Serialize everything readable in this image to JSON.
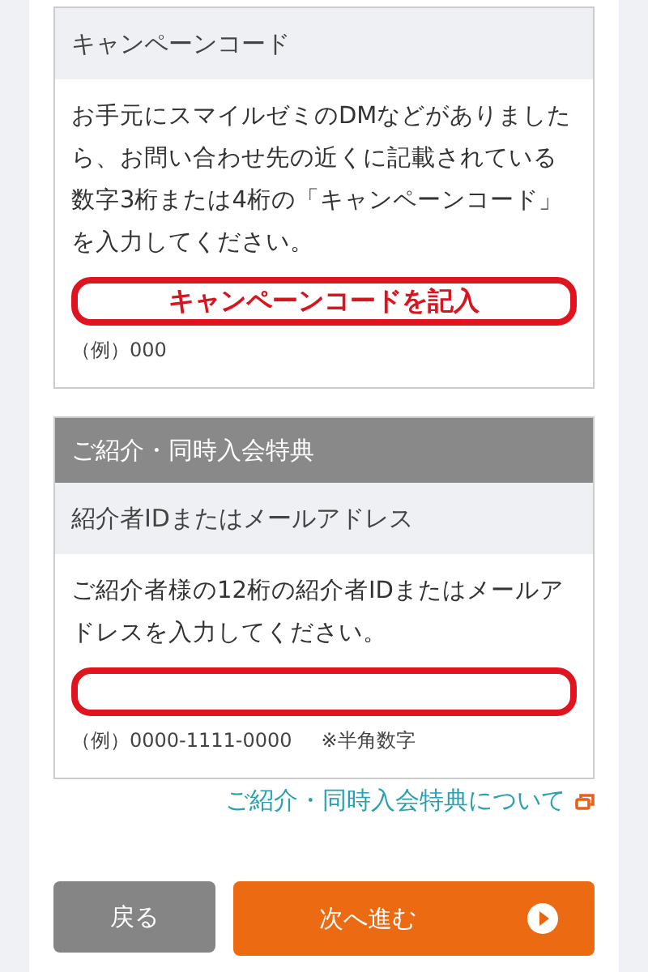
{
  "campaign": {
    "title": "キャンペーンコード",
    "description": "お手元にスマイルゼミのDMなどがありましたら、お問い合わせ先の近くに記載されている数字3桁または4桁の「キャンペーンコード」を入力してください。",
    "field": {
      "value": "キャンペーンコードを記入"
    },
    "example": "（例）000"
  },
  "referral": {
    "banner": "ご紹介・同時入会特典",
    "title": "紹介者IDまたはメールアドレス",
    "description": "ご紹介者様の12桁の紹介者IDまたはメールアドレスを入力してください。",
    "example": "（例）0000-1111-0000",
    "note": "※半角数字"
  },
  "link": "ご紹介・同時入会特典について",
  "buttons": {
    "back": "戻る",
    "next": "次へ進む"
  }
}
